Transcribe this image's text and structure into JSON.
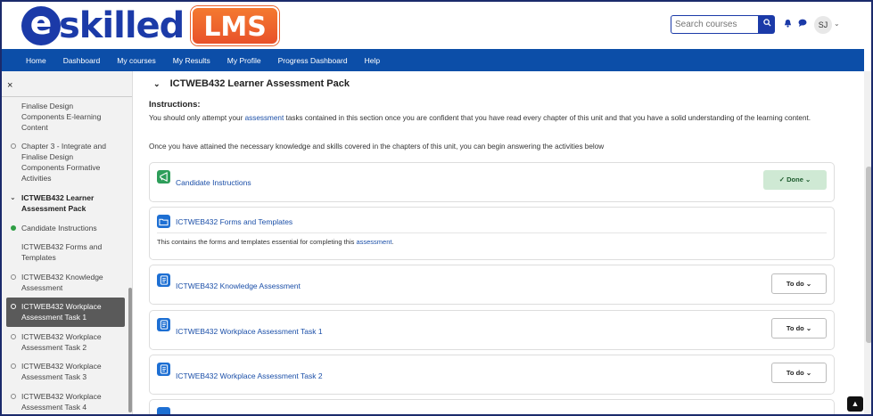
{
  "brand": {
    "logo_e": "e",
    "logo_text": "skilled",
    "logo_badge": "LMS"
  },
  "header": {
    "search_placeholder": "Search courses",
    "search_icon": "search-icon",
    "notification_icon": "bell-icon",
    "messages_icon": "chat-icon",
    "avatar_initials": "SJ"
  },
  "nav": {
    "items": [
      "Home",
      "Dashboard",
      "My courses",
      "My Results",
      "My Profile",
      "Progress Dashboard",
      "Help"
    ]
  },
  "sidebar": {
    "close_icon": "×",
    "items": [
      {
        "label": "Finalise Design Components E-learning Content",
        "status": "none"
      },
      {
        "label": "Chapter 3 - Integrate and Finalise Design Components Formative Activities",
        "status": "incomplete"
      },
      {
        "label": "ICTWEB432 Learner Assessment Pack",
        "status": "section"
      },
      {
        "label": "Candidate Instructions",
        "status": "done"
      },
      {
        "label": "ICTWEB432 Forms and Templates",
        "status": "none"
      },
      {
        "label": "ICTWEB432 Knowledge Assessment",
        "status": "incomplete"
      },
      {
        "label": "ICTWEB432 Workplace Assessment Task 1",
        "status": "active"
      },
      {
        "label": "ICTWEB432 Workplace Assessment Task 2",
        "status": "incomplete"
      },
      {
        "label": "ICTWEB432 Workplace Assessment Task 3",
        "status": "incomplete"
      },
      {
        "label": "ICTWEB432 Workplace Assessment Task 4",
        "status": "incomplete"
      }
    ]
  },
  "main": {
    "section_title": "ICTWEB432 Learner Assessment Pack",
    "instructions_heading": "Instructions:",
    "para1_before": "You should only attempt your ",
    "para1_link": "assessment",
    "para1_after": " tasks contained in this section once you are confident that you have read every chapter of this unit and that you have a solid understanding of the learning content.",
    "para2": "Once you have attained the necessary knowledge and skills covered in the chapters of this unit, you can begin answering the activities below",
    "activities": [
      {
        "title": "Candidate Instructions",
        "type": "announcement",
        "button": "Done",
        "status": "done"
      },
      {
        "title": "ICTWEB432 Forms and Templates",
        "type": "folder",
        "desc_before": "This contains the forms and templates essential for completing this ",
        "desc_link": "assessment",
        "desc_after": "."
      },
      {
        "title": "ICTWEB432 Knowledge Assessment",
        "type": "assignment",
        "button": "To do",
        "status": "todo"
      },
      {
        "title": "ICTWEB432 Workplace Assessment Task 1",
        "type": "assignment",
        "button": "To do",
        "status": "todo"
      },
      {
        "title": "ICTWEB432 Workplace Assessment Task 2",
        "type": "assignment",
        "button": "To do",
        "status": "todo"
      }
    ]
  },
  "colors": {
    "brand_blue": "#1b3aa8",
    "nav_blue": "#0c4ea8",
    "lms_orange": "#e8612a",
    "done_green": "#2e9e44"
  }
}
